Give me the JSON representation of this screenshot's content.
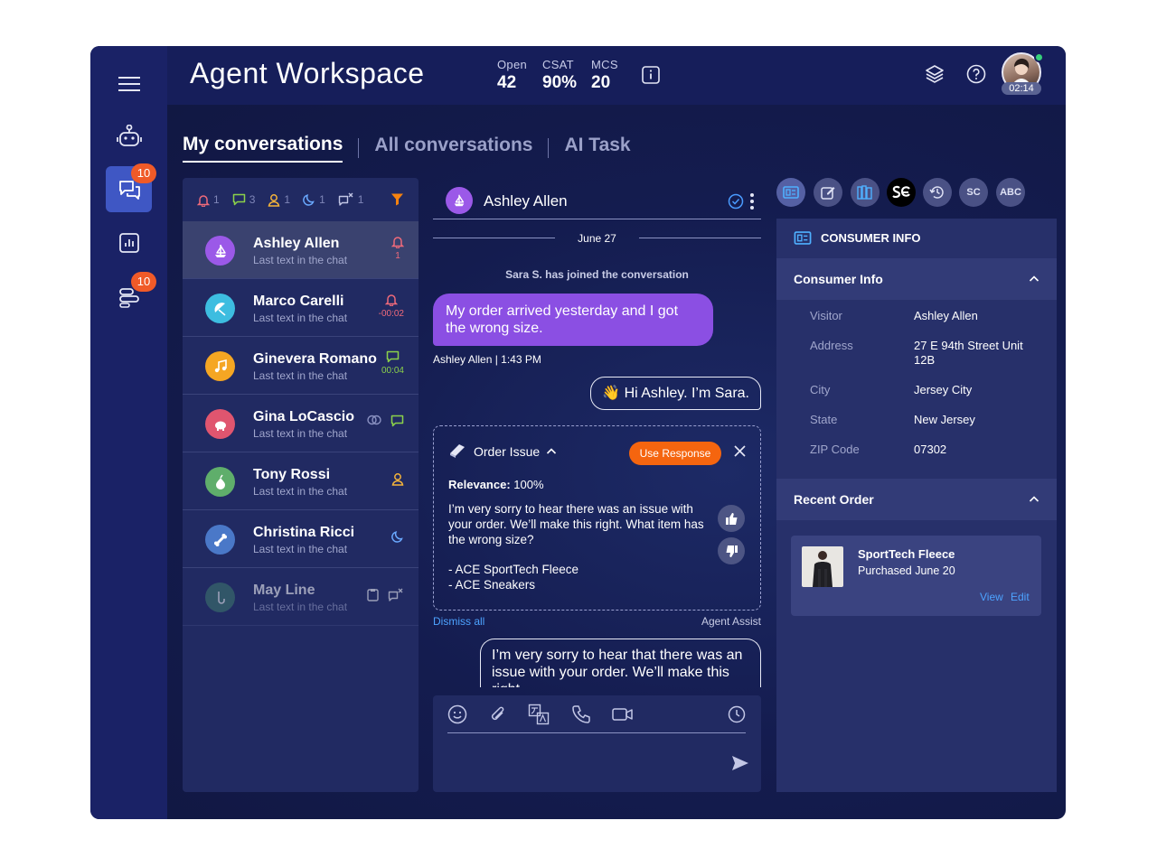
{
  "header": {
    "title": "Agent Workspace",
    "stats": [
      {
        "label": "Open",
        "value": "42"
      },
      {
        "label": "CSAT",
        "value": "90%"
      },
      {
        "label": "MCS",
        "value": "20"
      }
    ],
    "timer": "02:14"
  },
  "rail": {
    "chat_badge": "10",
    "tasks_badge": "10"
  },
  "tabs": [
    "My conversations",
    "All conversations",
    "AI Task"
  ],
  "filters": {
    "alerts": "1",
    "messages": "3",
    "users": "1",
    "night": "1",
    "transfers": "1"
  },
  "conversations": [
    {
      "name": "Ashley Allen",
      "last": "Last text in the chat",
      "meta": "1",
      "color": "#9b59e8"
    },
    {
      "name": "Marco Carelli",
      "last": "Last text in the chat",
      "meta": "-00:02",
      "color": "#3dbde0"
    },
    {
      "name": "Ginevera Romano",
      "last": "Last text in the chat",
      "meta": "00:04",
      "color": "#f5a623"
    },
    {
      "name": "Gina LoCascio",
      "last": "Last text in the chat",
      "meta": "",
      "color": "#e0556f"
    },
    {
      "name": "Tony Rossi",
      "last": "Last text in the chat",
      "meta": "",
      "color": "#5fae6b"
    },
    {
      "name": "Christina Ricci",
      "last": "Last text in the chat",
      "meta": "",
      "color": "#4a78c8"
    },
    {
      "name": "May Line",
      "last": "Last text in the chat",
      "meta": "",
      "color": "#3f7a6d"
    }
  ],
  "chat": {
    "contact": "Ashley Allen",
    "date": "June 27",
    "system": "Sara S. has joined the conversation",
    "customer_msg": "My order arrived yesterday and I got the wrong size.",
    "customer_meta": "Ashley Allen  |  1:43 PM",
    "agent_greeting": "👋 Hi Ashley. I’m Sara.",
    "assist": {
      "title": "Order Issue",
      "use_button": "Use Response",
      "relevance_label": "Relevance:",
      "relevance_value": "100%",
      "body": "I’m very sorry to hear there was an issue with your order. We’ll make this right. What item has the wrong size?",
      "item1": "- ACE SportTech Fleece",
      "item2": "- ACE Sneakers"
    },
    "dismiss": "Dismiss all",
    "assist_label": "Agent Assist",
    "draft": "I’m very sorry to hear that there was an issue with your order. We’ll make this right."
  },
  "right_tabs": [
    "SC",
    "ABC"
  ],
  "consumer": {
    "panel_title": "CONSUMER INFO",
    "section": "Consumer Info",
    "rows": [
      {
        "key": "Visitor",
        "value": "Ashley Allen"
      },
      {
        "key": "Address",
        "value": "27 E 94th Street Unit 12B"
      },
      {
        "key": "City",
        "value": "Jersey City"
      },
      {
        "key": "State",
        "value": "New Jersey"
      },
      {
        "key": "ZIP Code",
        "value": "07302"
      }
    ],
    "recent_section": "Recent Order",
    "order": {
      "name": "SportTech Fleece",
      "purchased": "Purchased June 20",
      "view": "View",
      "edit": "Edit"
    }
  },
  "colors": {
    "accent_purple": "#8b4fe3",
    "accent_orange": "#f5650f",
    "badge": "#f05a28"
  }
}
